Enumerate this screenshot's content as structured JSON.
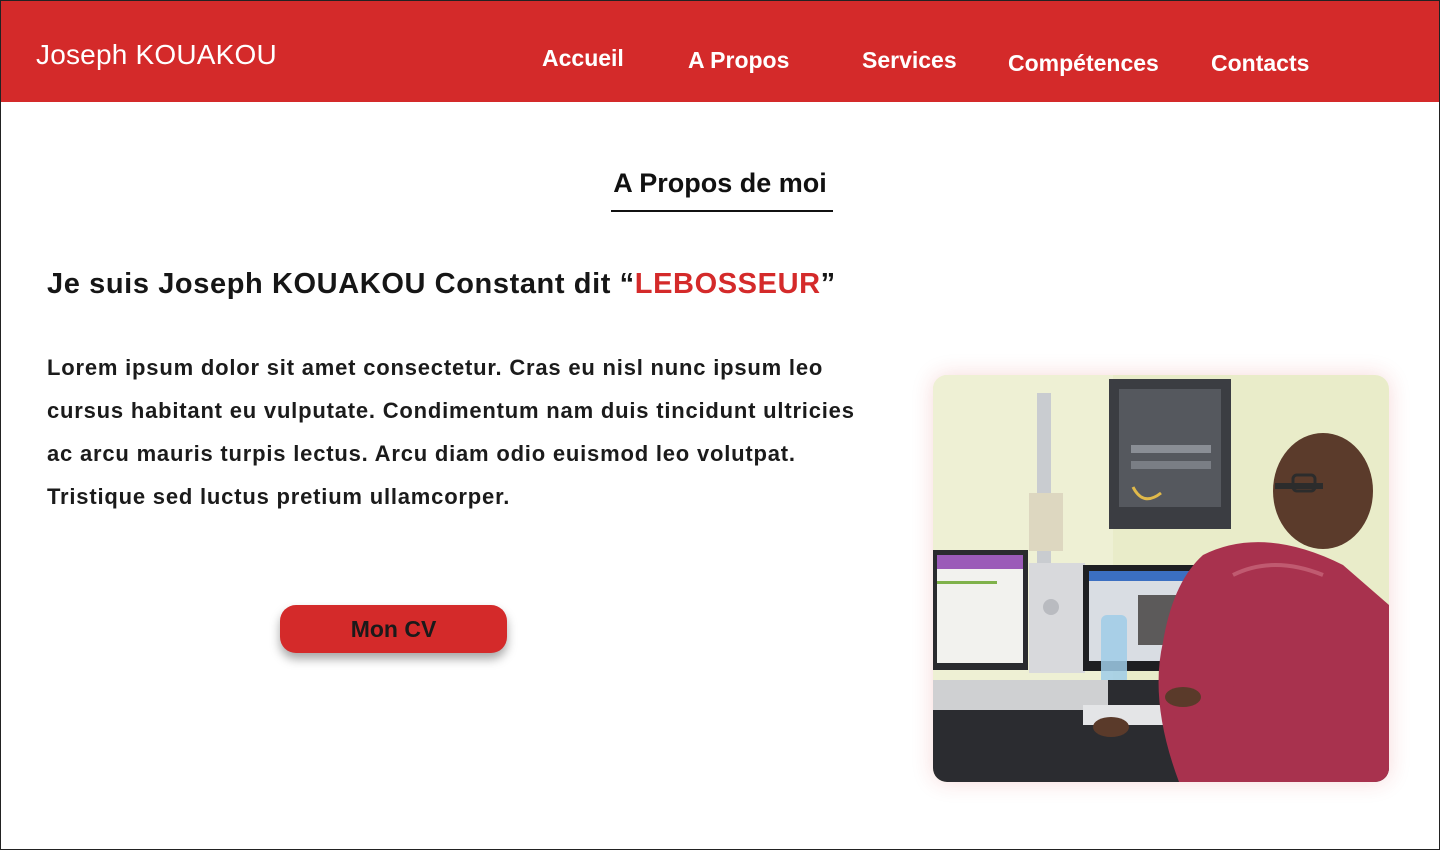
{
  "header": {
    "brand": "Joseph KOUAKOU",
    "nav": [
      {
        "label": "Accueil"
      },
      {
        "label": "A Propos"
      },
      {
        "label": "Services"
      },
      {
        "label": "Compétences"
      },
      {
        "label": "Contacts"
      }
    ]
  },
  "about": {
    "section_title": "A Propos de moi",
    "headline_prefix": "Je suis Joseph KOUAKOU Constant dit “",
    "headline_nickname": "LEBOSSEUR",
    "headline_suffix": "”",
    "paragraph": "Lorem ipsum dolor sit amet consectetur. Cras eu nisl nunc ipsum leo cursus habitant eu vulputate. Condimentum nam duis tincidunt ultricies ac arcu mauris turpis lectus. Arcu diam odio euismod leo volutpat. Tristique sed luctus pretium ullamcorper.",
    "cv_button": "Mon CV"
  },
  "colors": {
    "brand_red": "#d42a2a",
    "text_dark": "#161616"
  }
}
